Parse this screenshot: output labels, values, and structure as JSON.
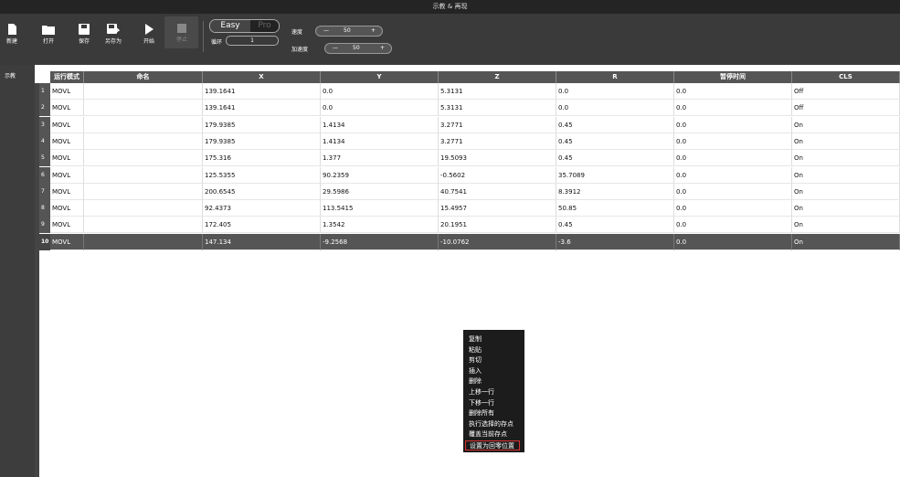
{
  "window": {
    "title": "示教 & 再现"
  },
  "toolbar": {
    "new_label": "新建",
    "open_label": "打开",
    "save_label": "保存",
    "save_as_label": "另存为",
    "start_label": "开始",
    "stop_label": "停止",
    "mode_easy": "Easy",
    "mode_pro": "Pro",
    "loop_label": "循环",
    "loop_value": "1",
    "speed_label": "速度",
    "speed_value": "50",
    "accel_label": "加速度",
    "accel_value": "50",
    "minus": "—",
    "plus": "+"
  },
  "sidebar": {
    "tab_label": "示教"
  },
  "table": {
    "headers": [
      "运行模式",
      "命名",
      "X",
      "Y",
      "Z",
      "R",
      "暂停时间",
      "CLS"
    ],
    "rows": [
      {
        "idx": "1",
        "mode": "MOVL",
        "name": "",
        "x": "139.1641",
        "y": "0.0",
        "z": "5.3131",
        "r": "0.0",
        "pause": "0.0",
        "cls": "Off"
      },
      {
        "idx": "2",
        "mode": "MOVL",
        "name": "",
        "x": "139.1641",
        "y": "0.0",
        "z": "5.3131",
        "r": "0.0",
        "pause": "0.0",
        "cls": "Off"
      },
      {
        "idx": "3",
        "mode": "MOVL",
        "name": "",
        "x": "179.9385",
        "y": "1.4134",
        "z": "3.2771",
        "r": "0.45",
        "pause": "0.0",
        "cls": "On"
      },
      {
        "idx": "4",
        "mode": "MOVL",
        "name": "",
        "x": "179.9385",
        "y": "1.4134",
        "z": "3.2771",
        "r": "0.45",
        "pause": "0.0",
        "cls": "On"
      },
      {
        "idx": "5",
        "mode": "MOVL",
        "name": "",
        "x": "175.316",
        "y": "1.377",
        "z": "19.5093",
        "r": "0.45",
        "pause": "0.0",
        "cls": "On"
      },
      {
        "idx": "6",
        "mode": "MOVL",
        "name": "",
        "x": "125.5355",
        "y": "90.2359",
        "z": "-0.5602",
        "r": "35.7089",
        "pause": "0.0",
        "cls": "On"
      },
      {
        "idx": "7",
        "mode": "MOVL",
        "name": "",
        "x": "200.6545",
        "y": "29.5986",
        "z": "40.7541",
        "r": "8.3912",
        "pause": "0.0",
        "cls": "On"
      },
      {
        "idx": "8",
        "mode": "MOVL",
        "name": "",
        "x": "92.4373",
        "y": "113.5415",
        "z": "15.4957",
        "r": "50.85",
        "pause": "0.0",
        "cls": "On"
      },
      {
        "idx": "9",
        "mode": "MOVL",
        "name": "",
        "x": "172.405",
        "y": "1.3542",
        "z": "20.1951",
        "r": "0.45",
        "pause": "0.0",
        "cls": "On"
      },
      {
        "idx": "10",
        "mode": "MOVL",
        "name": "",
        "x": "147.134",
        "y": "-9.2568",
        "z": "-10.0762",
        "r": "-3.6",
        "pause": "0.0",
        "cls": "On"
      }
    ],
    "selected_row": "10"
  },
  "context_menu": {
    "items": [
      "复制",
      "粘贴",
      "剪切",
      "插入",
      "删除",
      "上移一行",
      "下移一行",
      "删除所有",
      "执行选择的存点",
      "覆盖当前存点",
      "设置为回零位置"
    ],
    "highlighted": "设置为回零位置"
  }
}
